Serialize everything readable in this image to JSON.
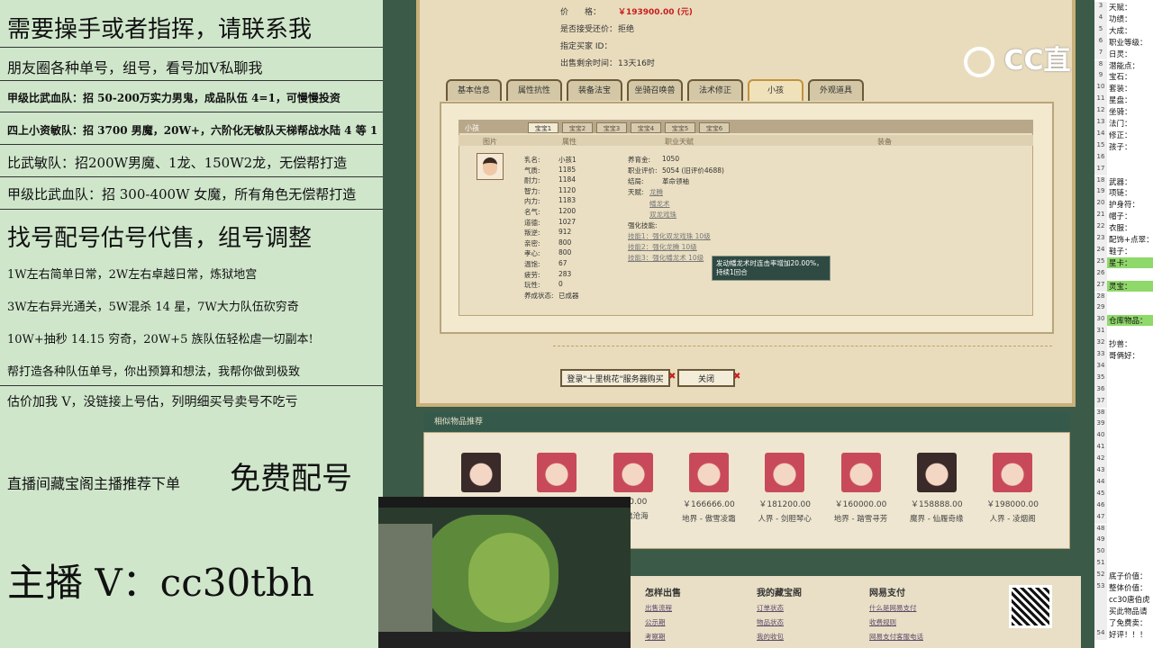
{
  "ad": {
    "lines": [
      "需要操手或者指挥，请联系我",
      "朋友圈各种单号，组号，看号加V私聊我",
      "甲级比武血队：招 50-200万实力男鬼，成品队伍 4=1，可慢慢投资",
      "四上小资敏队：招 3700 男魔，20W+，六阶化无敏队天梯帮战水陆 4 等 1",
      "比武敏队：招200W男魔、1龙、150W2龙，无偿帮打造",
      "甲级比武血队：招 300-400W 女魔，所有角色无偿帮打造",
      "找号配号估号代售，组号调整",
      "1W左右简单日常，2W左右卓越日常，炼狱地宫",
      "3W左右异光通关，5W混杀 14 星，7W大力队伍砍穷奇",
      "10W+抽秒 14.15 穷奇，20W+5 族队伍轻松虐一切副本!",
      "帮打造各种队伍单号，你出预算和想法，我帮你做到极致",
      "估价加我 V，没链接上号估，列明细买号卖号不吃亏",
      "直播间藏宝阁主播推荐下单",
      "免费配号",
      "主播 V：cc30tbh"
    ]
  },
  "listing": {
    "price_label": "价　　格：",
    "price_value": "￥193900.00 (元)",
    "bargain_label": "是否接受还价：",
    "bargain_value": "拒绝",
    "buyer_label": "指定买家 ID：",
    "buyer_value": "",
    "remain_label": "出售剩余时间：",
    "remain_value": "13天16时"
  },
  "tabs": [
    "基本信息",
    "属性抗性",
    "装备法宝",
    "坐骑召唤兽",
    "法术修正",
    "小孩",
    "外观道具"
  ],
  "active_tab": "小孩",
  "child": {
    "section_title": "小孩",
    "sub_tabs": [
      "宝宝1",
      "宝宝2",
      "宝宝3",
      "宝宝4",
      "宝宝5",
      "宝宝6"
    ],
    "col_headers": [
      "图片",
      "属性",
      "职业天赋",
      "装备"
    ],
    "stats": [
      {
        "k": "乳名:",
        "v": "小孩1"
      },
      {
        "k": "气质:",
        "v": "1185"
      },
      {
        "k": "耐力:",
        "v": "1184"
      },
      {
        "k": "智力:",
        "v": "1120"
      },
      {
        "k": "内力:",
        "v": "1183"
      },
      {
        "k": "名气:",
        "v": "1200"
      },
      {
        "k": "道德:",
        "v": "1027"
      },
      {
        "k": "叛逆:",
        "v": "912"
      },
      {
        "k": "亲密:",
        "v": "800"
      },
      {
        "k": "孝心:",
        "v": "800"
      },
      {
        "k": "温饱:",
        "v": "67"
      },
      {
        "k": "疲劳:",
        "v": "283"
      },
      {
        "k": "玩性:",
        "v": "0"
      },
      {
        "k": "养成状态:",
        "v": "已成器"
      }
    ],
    "career": [
      {
        "k": "养育金:",
        "v": "1050"
      },
      {
        "k": "职业评价:",
        "v": "5054 (旧评价4688)"
      },
      {
        "k": "结局:",
        "v": "革命领袖"
      },
      {
        "k": "天赋:",
        "v": "龙腾"
      }
    ],
    "talents_extra": [
      "幡龙术",
      "双龙戏珠"
    ],
    "skills_label": "强化技能:",
    "skills": [
      "技能1：强化双龙戏珠 10级",
      "技能2：强化龙腾 10级",
      "技能3：强化幡龙术 10级"
    ],
    "tooltip": "发动幡龙术时连击率增加20.00%，持续1回合"
  },
  "buttons": {
    "buy": "登录\"十里桃花\"服务器购买",
    "close": "关闭"
  },
  "similar": {
    "title": "相似物品推荐",
    "items": [
      {
        "price": "",
        "server": ""
      },
      {
        "price": "",
        "server": ""
      },
      {
        "price": "000.00",
        "server": "渔樵沧海"
      },
      {
        "price": "￥166666.00",
        "server": "地界 - 傲雪凌霜"
      },
      {
        "price": "￥181200.00",
        "server": "人界 - 剑胆琴心"
      },
      {
        "price": "￥160000.00",
        "server": "地界 - 踏雪寻芳"
      },
      {
        "price": "￥158888.00",
        "server": "魔界 - 仙履奇缘"
      },
      {
        "price": "￥198000.00",
        "server": "人界 - 凌烟阁"
      }
    ]
  },
  "footer": {
    "cols": [
      {
        "title": "怎样出售",
        "links": [
          "出售流程",
          "公示期",
          "考察期"
        ]
      },
      {
        "title": "我的藏宝阁",
        "links": [
          "订单状态",
          "物品状态",
          "我的收包"
        ]
      },
      {
        "title": "网易支付",
        "links": [
          "什么是网易支付",
          "收费规则",
          "网易支付客服电话"
        ]
      }
    ]
  },
  "logo": "CC直",
  "sheet": {
    "rows": [
      {
        "n": "3",
        "t": "天赋："
      },
      {
        "n": "4",
        "t": "功绩："
      },
      {
        "n": "5",
        "t": "大成："
      },
      {
        "n": "6",
        "t": "职业等级："
      },
      {
        "n": "7",
        "t": "日灵："
      },
      {
        "n": "8",
        "t": "潜能点："
      },
      {
        "n": "9",
        "t": "宝石："
      },
      {
        "n": "10",
        "t": "套装："
      },
      {
        "n": "11",
        "t": "星盘："
      },
      {
        "n": "12",
        "t": "坐骑："
      },
      {
        "n": "13",
        "t": "法门："
      },
      {
        "n": "14",
        "t": "修正："
      },
      {
        "n": "15",
        "t": "孩子："
      },
      {
        "n": "16",
        "t": ""
      },
      {
        "n": "17",
        "t": ""
      },
      {
        "n": "18",
        "t": "武器："
      },
      {
        "n": "19",
        "t": "项链："
      },
      {
        "n": "20",
        "t": "护身符："
      },
      {
        "n": "21",
        "t": "帽子："
      },
      {
        "n": "22",
        "t": "衣服："
      },
      {
        "n": "23",
        "t": "配饰+点翠："
      },
      {
        "n": "24",
        "t": "鞋子："
      },
      {
        "n": "25",
        "t": "星卡："
      },
      {
        "n": "26",
        "t": ""
      },
      {
        "n": "27",
        "t": "灵宝："
      },
      {
        "n": "28",
        "t": ""
      },
      {
        "n": "29",
        "t": ""
      },
      {
        "n": "30",
        "t": "仓库物品："
      },
      {
        "n": "31",
        "t": ""
      },
      {
        "n": "32",
        "t": "抄兽："
      },
      {
        "n": "33",
        "t": "哥俩好："
      },
      {
        "n": "34",
        "t": ""
      },
      {
        "n": "35",
        "t": ""
      },
      {
        "n": "36",
        "t": ""
      },
      {
        "n": "37",
        "t": ""
      },
      {
        "n": "38",
        "t": ""
      },
      {
        "n": "39",
        "t": ""
      },
      {
        "n": "40",
        "t": ""
      },
      {
        "n": "41",
        "t": ""
      },
      {
        "n": "42",
        "t": ""
      },
      {
        "n": "43",
        "t": ""
      },
      {
        "n": "44",
        "t": ""
      },
      {
        "n": "45",
        "t": ""
      },
      {
        "n": "46",
        "t": ""
      },
      {
        "n": "47",
        "t": ""
      },
      {
        "n": "48",
        "t": ""
      },
      {
        "n": "49",
        "t": ""
      },
      {
        "n": "50",
        "t": ""
      },
      {
        "n": "51",
        "t": ""
      },
      {
        "n": "52",
        "t": "底子价值："
      },
      {
        "n": "53",
        "t": "整体价值："
      },
      {
        "n": "",
        "t": "cc30唐伯虎"
      },
      {
        "n": "",
        "t": "买此物品请"
      },
      {
        "n": "",
        "t": "了免费卖："
      },
      {
        "n": "54",
        "t": "好评！！！"
      }
    ],
    "highlight_color": "#8fd86a"
  }
}
